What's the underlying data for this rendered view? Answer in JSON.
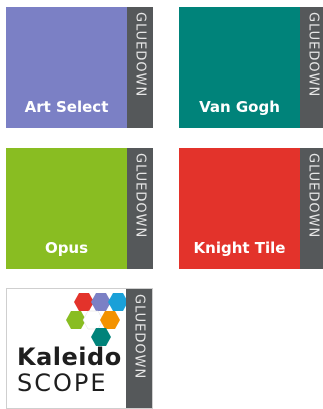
{
  "brand_strip": "GLUEDOWN",
  "tiles": [
    {
      "name": "Art Select",
      "color": "#7b80c5"
    },
    {
      "name": "Van Gogh",
      "color": "#00837a"
    },
    {
      "name": "Opus",
      "color": "#89bd22"
    },
    {
      "name": "Knight Tile",
      "color": "#e3332b"
    }
  ],
  "kaleido": {
    "line1": "Kaleido",
    "line2": "SCOPE"
  }
}
